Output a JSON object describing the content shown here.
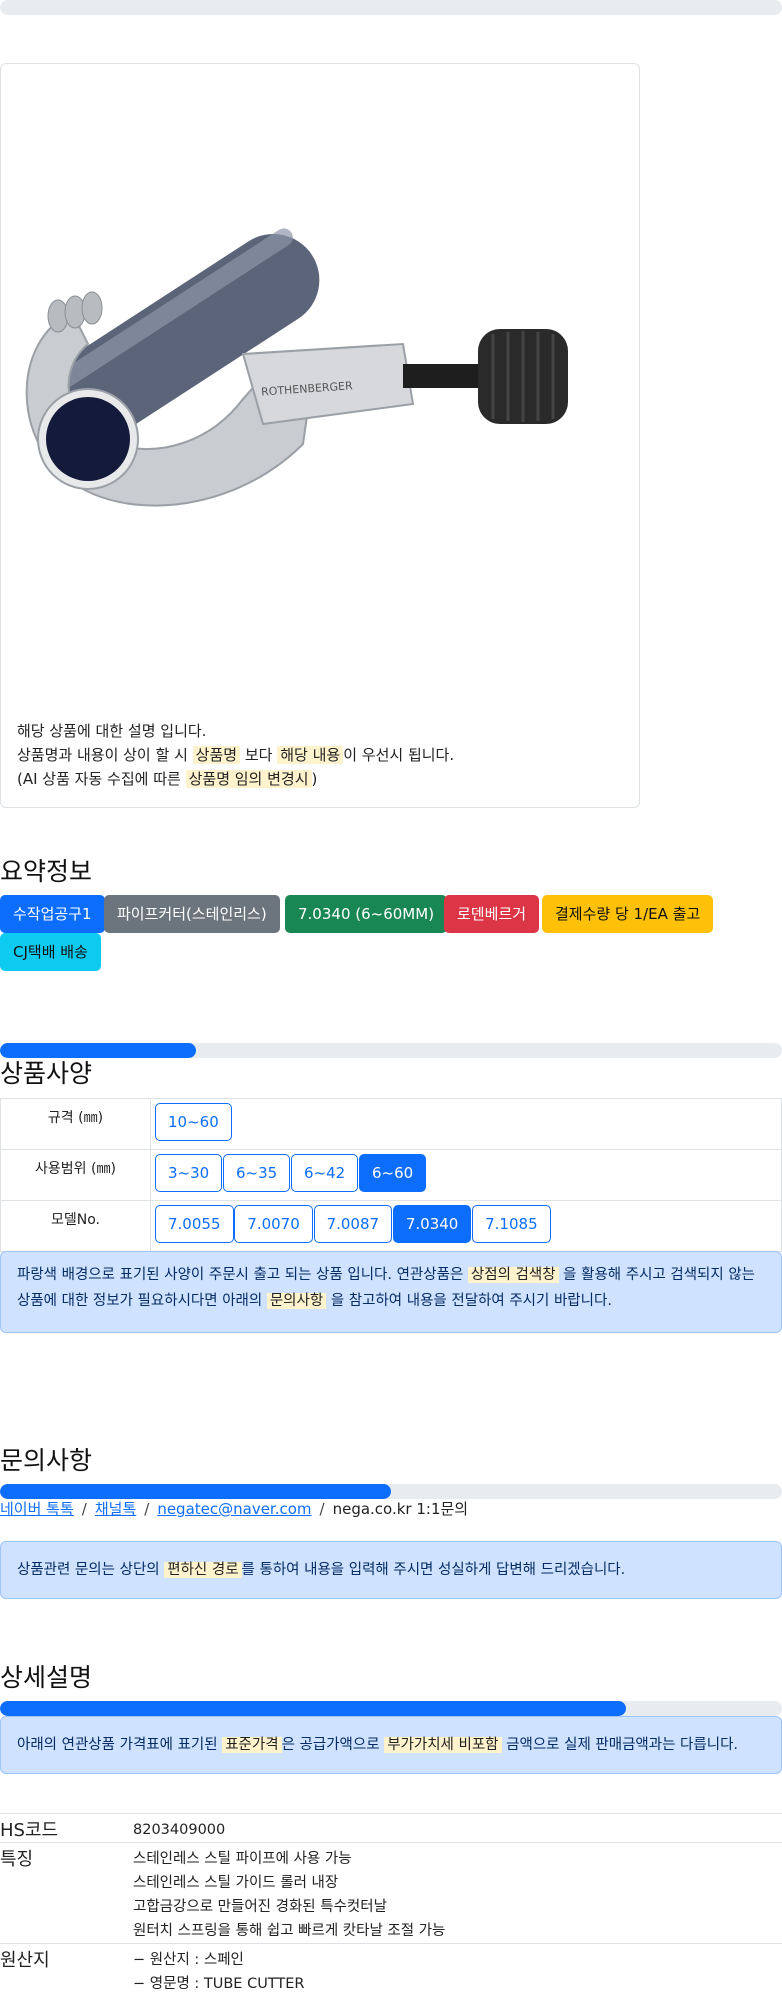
{
  "product": {
    "image_alt": "ROTHENBERGER",
    "description": {
      "line1": "해당 상품에 대한 설명 입니다.",
      "line2_a": "상품명과 내용이 상이 할 시",
      "line2_hl1": "상품명",
      "line2_b": "보다",
      "line2_hl2": "해당 내용",
      "line2_c": "이 우선시 됩니다.",
      "line3_a": "(AI 상품 자동 수집에 따른",
      "line3_hl": "상품명 임의 변경시",
      "line3_b": ")"
    }
  },
  "summary": {
    "title": "요약정보",
    "badges": [
      {
        "label": "수작업공구1",
        "color": "#0d6efd",
        "text_color": "#ffffff"
      },
      {
        "label": "파이프커터(스테인리스)",
        "color": "#6c757d",
        "text_color": "#ffffff"
      },
      {
        "label": "7.0340 (6~60MM)",
        "color": "#198754",
        "text_color": "#ffffff"
      },
      {
        "label": "로덴베르거",
        "color": "#dc3545",
        "text_color": "#ffffff"
      },
      {
        "label": "결제수량 당 1/EA 출고",
        "color": "#ffc107",
        "text_color": "#111111"
      },
      {
        "label": "CJ택배 배송",
        "color": "#0dcaf0",
        "text_color": "#111111"
      }
    ]
  },
  "spec": {
    "title": "상품사양",
    "progress": 0.25,
    "rows": [
      {
        "label": "규격 (㎜)",
        "options": [
          {
            "text": "10~60",
            "selected": false
          }
        ]
      },
      {
        "label": "사용범위 (㎜)",
        "options": [
          {
            "text": "3~30",
            "selected": false
          },
          {
            "text": "6~35",
            "selected": false
          },
          {
            "text": "6~42",
            "selected": false
          },
          {
            "text": "6~60",
            "selected": true
          }
        ]
      },
      {
        "label": "모델No.",
        "options": [
          {
            "text": "7.0055",
            "selected": false
          },
          {
            "text": "7.0070",
            "selected": false
          },
          {
            "text": "7.0087",
            "selected": false
          },
          {
            "text": "7.0340",
            "selected": true
          },
          {
            "text": "7.1085",
            "selected": false
          }
        ]
      }
    ],
    "note": {
      "a": "파랑색 배경으로 표기된 사양이 주문시 출고 되는 상품 입니다. 연관상품은",
      "hl1": "상점의 검색창",
      "b": "을 활용해 주시고 검색되지 않는 상품에 대한 정보가 필요하시다면 아래의",
      "hl2": "문의사항",
      "c": "을 참고하여 내용을 전달하여 주시기 바랍니다."
    }
  },
  "inquiry": {
    "title": "문의사항",
    "progress": 0.5,
    "links": [
      "네이버 톡톡",
      "채널톡",
      "negatec@naver.com"
    ],
    "plain": "nega.co.kr 1:1문의",
    "note": {
      "a": "상품관련 문의는 상단의",
      "hl": "편하신 경로",
      "b": "를 통하여 내용을 입력해 주시면 성실하게 답변해 드리겠습니다."
    }
  },
  "detail": {
    "title": "상세설명",
    "progress": 0.8,
    "note": {
      "a": "아래의 연관상품 가격표에 표기된",
      "hl1": "표준가격",
      "b": "은 공급가액으로",
      "hl2": "부가가치세 비포함",
      "c": "금액으로 실제 판매금액과는 다릅니다."
    },
    "rows": [
      {
        "key": "HS코드",
        "values": [
          "8203409000"
        ]
      },
      {
        "key": "특징",
        "values": [
          "스테인레스 스틸 파이프에 사용 가능",
          "스테인레스 스틸 가이드 롤러 내장",
          "고합금강으로 만들어진 경화된 특수컷터날",
          "원터치 스프링을 통해 쉽고 빠르게 캇타날 조절 가능"
        ]
      },
      {
        "key": "원산지",
        "values": [
          "− 원산지 : 스페인",
          "− 영문명 : TUBE CUTTER"
        ]
      }
    ]
  }
}
